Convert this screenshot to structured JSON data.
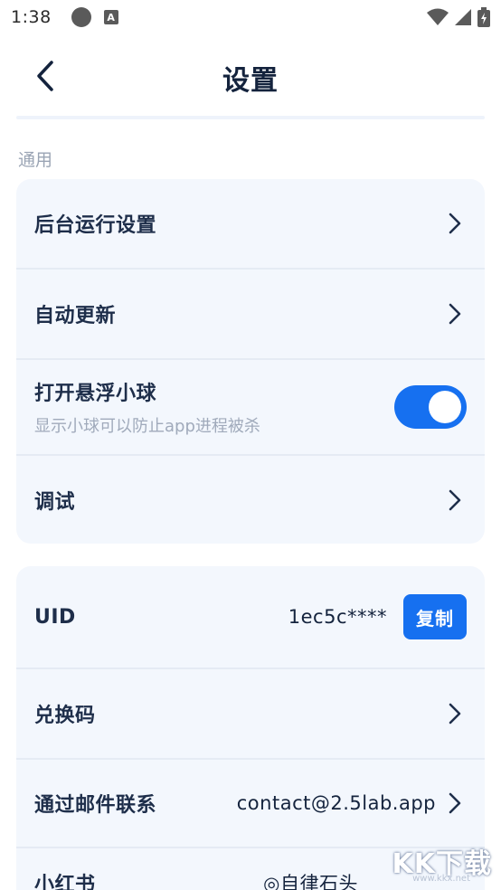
{
  "status_bar": {
    "time": "1:38",
    "a_badge": "A"
  },
  "header": {
    "title": "设置"
  },
  "sections": {
    "general_label": "通用"
  },
  "general": {
    "background_run": "后台运行设置",
    "auto_update": "自动更新",
    "floating_ball": {
      "label": "打开悬浮小球",
      "sub": "显示小球可以防止app进程被杀",
      "enabled": true
    },
    "debug": "调试"
  },
  "account": {
    "uid_label": "UID",
    "uid_value": "1ec5c****",
    "copy_label": "复制",
    "redeem": "兑换码",
    "email_label": "通过邮件联系",
    "email_value": "contact@2.5lab.app",
    "xiaohongshu_label": "小红书",
    "xiaohongshu_value": "◎自律石头"
  },
  "watermark": {
    "text": "KK下载",
    "url": "www.kkx.net"
  },
  "colors": {
    "accent": "#1670f0",
    "card_bg": "#f3f7fd",
    "text": "#1e2e4a",
    "muted": "#a0aabb"
  },
  "icons": [
    "back-arrow-icon",
    "chevron-right-icon",
    "wifi-icon",
    "signal-icon",
    "battery-icon"
  ]
}
